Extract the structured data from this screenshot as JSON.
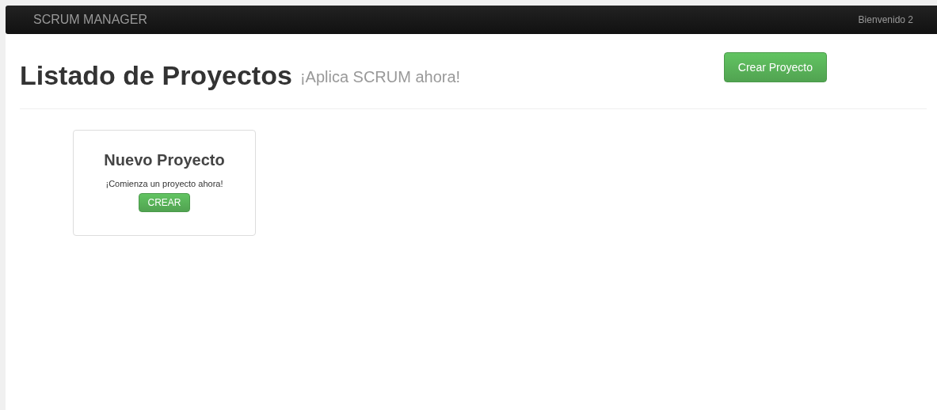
{
  "navbar": {
    "brand": "SCRUM MANAGER",
    "welcome": "Bienvenido 2"
  },
  "header": {
    "title": "Listado de Proyectos",
    "subtitle": "¡Aplica SCRUM ahora!",
    "button": "Crear Proyecto"
  },
  "cards": [
    {
      "title": "Nuevo Proyecto",
      "text": "¡Comienza un proyecto ahora!",
      "button": "CREAR"
    }
  ]
}
